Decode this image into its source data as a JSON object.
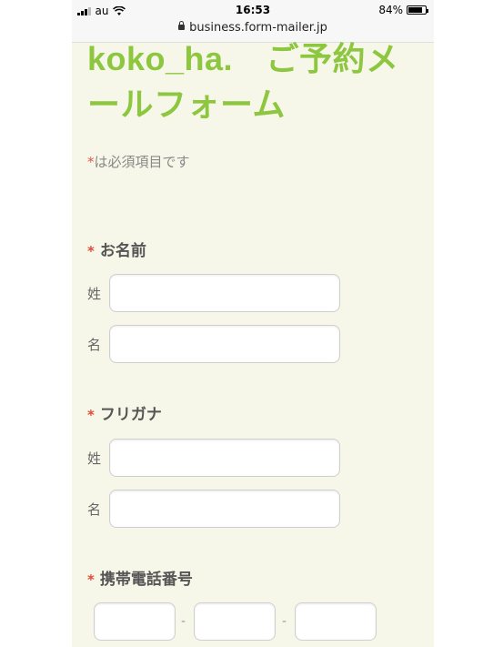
{
  "status_bar": {
    "carrier": "au",
    "time": "16:53",
    "battery": "84%",
    "battery_level": 0.84,
    "url": "business.form-mailer.jp"
  },
  "form": {
    "title": "koko_ha.　ご予約メールフォーム",
    "required_mark": "*",
    "required_note": "は必須項目です",
    "name": {
      "label": "お名前",
      "last_label": "姓",
      "first_label": "名",
      "last_value": "",
      "first_value": ""
    },
    "furigana": {
      "label": "フリガナ",
      "last_label": "姓",
      "first_label": "名",
      "last_value": "",
      "first_value": ""
    },
    "phone": {
      "label": "携帯電話番号",
      "separator": "-",
      "parts": [
        "",
        "",
        ""
      ]
    }
  }
}
